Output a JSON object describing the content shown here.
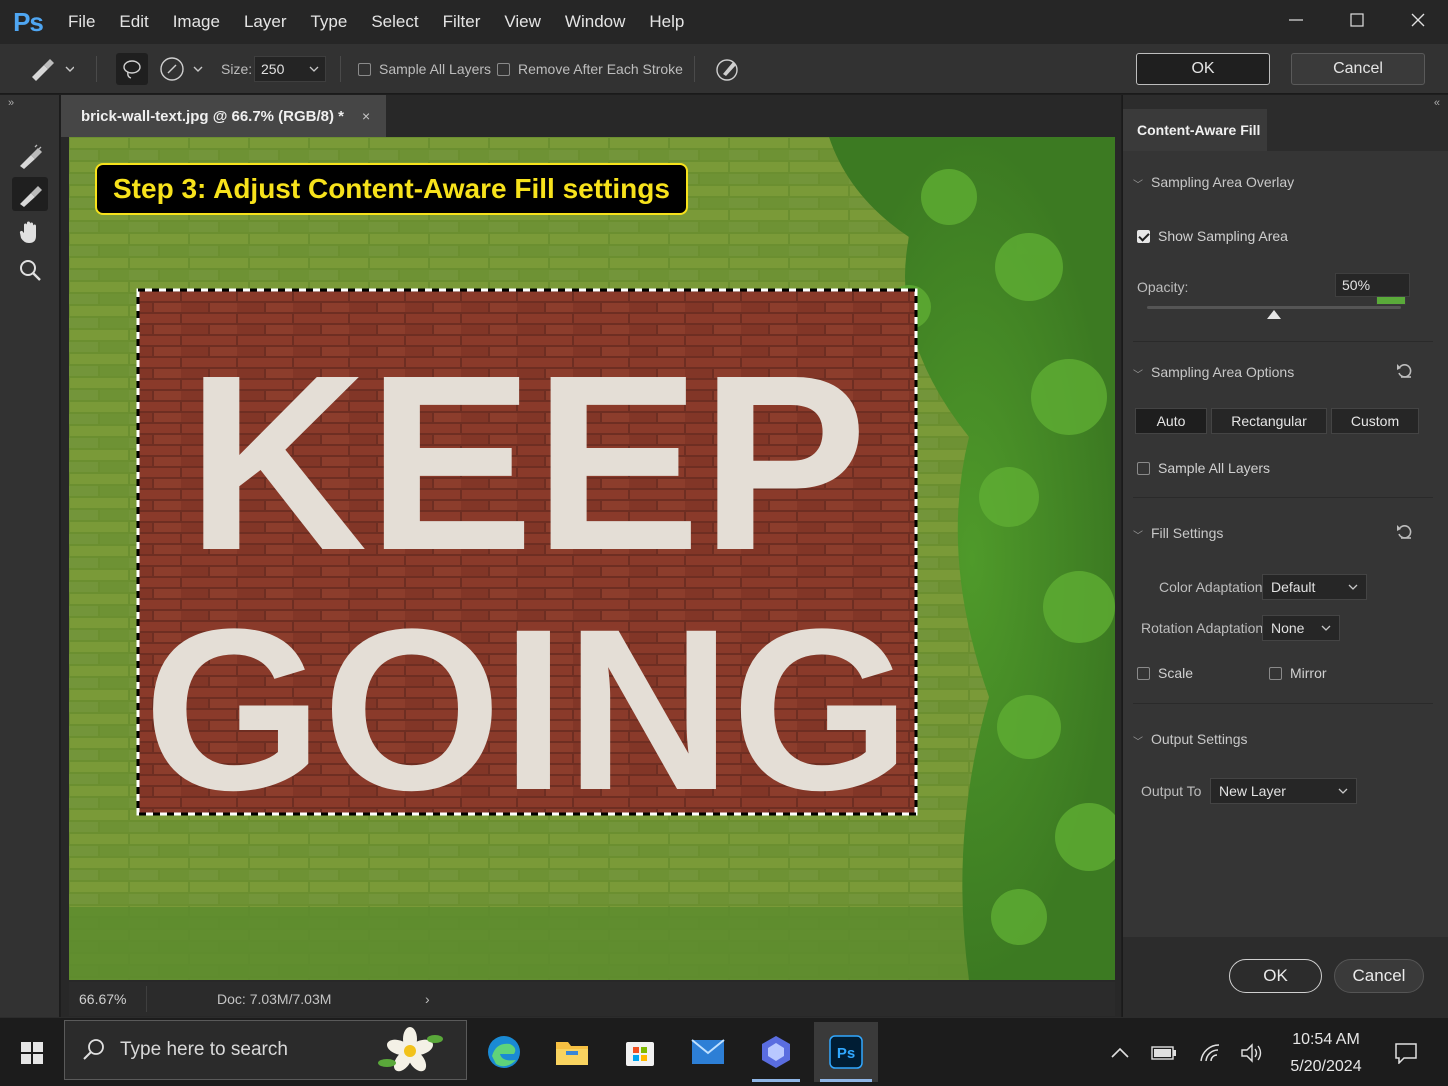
{
  "app": {
    "logo_text": "Ps",
    "menu": [
      "File",
      "Edit",
      "Image",
      "Layer",
      "Type",
      "Select",
      "Filter",
      "View",
      "Window",
      "Help"
    ]
  },
  "options_bar": {
    "size_label": "Size:",
    "size_value": "250",
    "sample_all_layers": "Sample All Layers",
    "sample_all_layers_checked": false,
    "remove_after_stroke": "Remove After Each Stroke",
    "remove_after_stroke_checked": false,
    "ok_label": "OK",
    "cancel_label": "Cancel"
  },
  "document": {
    "tab_title": "brick-wall-text.jpg @ 66.7% (RGB/8) *",
    "tab_close": "×",
    "canvas_text_line1": "KEEP",
    "canvas_text_line2": "GOING",
    "overlay_label": "Step 3: Adjust Content-Aware Fill settings",
    "overlay_color": "#f7e21b"
  },
  "status": {
    "zoom": "66.67%",
    "doc_label": "Doc:",
    "doc_size": "7.03M/7.03M",
    "arrow": "›"
  },
  "panel": {
    "title": "Content-Aware Fill",
    "sampling_overlay": {
      "title": "Sampling Area Overlay",
      "show_label": "Show Sampling Area",
      "show_checked": true,
      "swatch_color": "#5aaa3a",
      "opacity_label": "Opacity:",
      "opacity_value": "50%",
      "opacity_fraction": 0.5
    },
    "sampling_options": {
      "title": "Sampling Area Options",
      "buttons": [
        "Auto",
        "Rectangular",
        "Custom"
      ],
      "selected": "Auto",
      "sample_all_label": "Sample All Layers",
      "sample_all_checked": false
    },
    "fill_settings": {
      "title": "Fill Settings",
      "color_adapt_label": "Color Adaptation",
      "color_adapt_value": "Default",
      "rotation_adapt_label": "Rotation Adaptation",
      "rotation_adapt_value": "None",
      "scale_label": "Scale",
      "scale_checked": false,
      "mirror_label": "Mirror",
      "mirror_checked": false
    },
    "output_settings": {
      "title": "Output Settings",
      "output_to_label": "Output To",
      "output_to_value": "New Layer"
    },
    "ok_label": "OK",
    "cancel_label": "Cancel"
  },
  "taskbar": {
    "search_placeholder": "Type here to search",
    "time": "10:54 AM",
    "date": "5/20/2024",
    "apps": [
      "edge-icon",
      "file-explorer-icon",
      "store-icon",
      "mail-icon",
      "app-hexagon-icon",
      "photoshop-icon"
    ]
  }
}
